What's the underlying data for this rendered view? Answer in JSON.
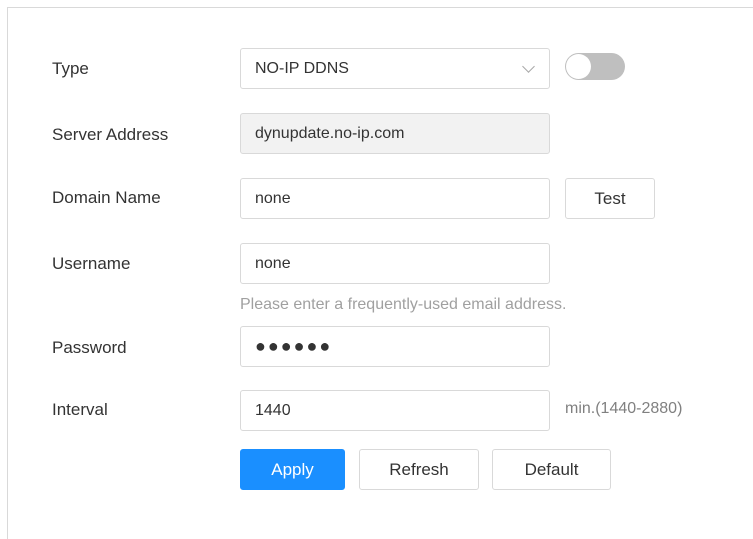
{
  "form": {
    "type": {
      "label": "Type",
      "value": "NO-IP DDNS",
      "enabled": false
    },
    "server_address": {
      "label": "Server Address",
      "value": "dynupdate.no-ip.com"
    },
    "domain_name": {
      "label": "Domain Name",
      "value": "none",
      "test_label": "Test"
    },
    "username": {
      "label": "Username",
      "value": "none",
      "hint": "Please enter a frequently-used email address."
    },
    "password": {
      "label": "Password",
      "value": "●●●●●●"
    },
    "interval": {
      "label": "Interval",
      "value": "1440",
      "suffix": "min.(1440-2880)"
    }
  },
  "buttons": {
    "apply": "Apply",
    "refresh": "Refresh",
    "default": "Default"
  },
  "colors": {
    "primary": "#1a8fff",
    "border": "#d9d9d9",
    "toggle_off": "#bfbfbf"
  },
  "icons": {
    "select_arrow": "chevron-down-icon"
  }
}
